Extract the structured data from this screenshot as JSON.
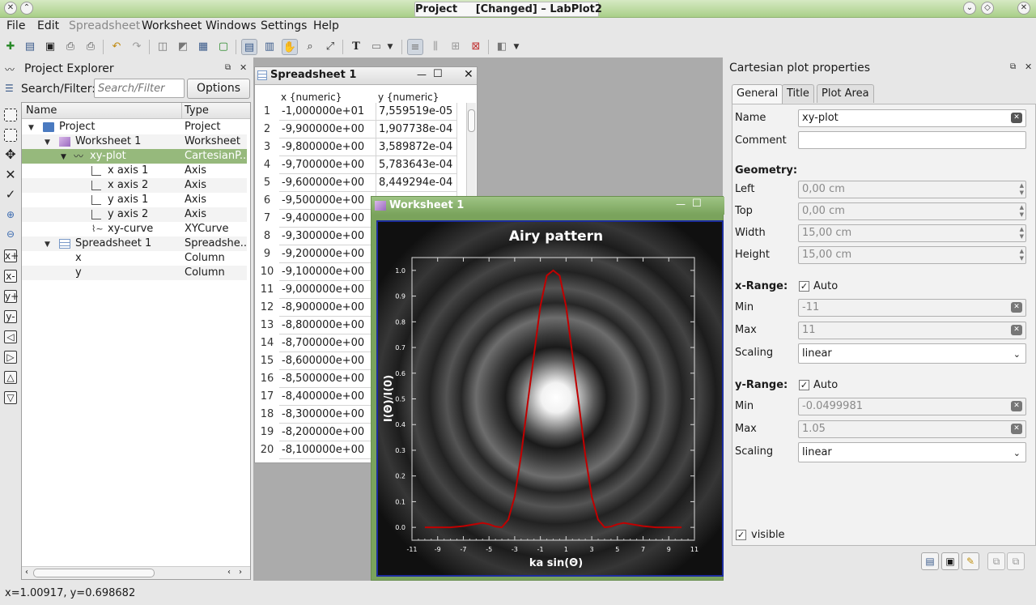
{
  "window": {
    "title": "Project     [Changed] – LabPlot2"
  },
  "menu": [
    "File",
    "Edit",
    "Spreadsheet",
    "Worksheet",
    "Windows",
    "Settings",
    "Help"
  ],
  "project_explorer": {
    "title": "Project Explorer",
    "search_label": "Search/Filter:",
    "search_placeholder": "Search/Filter",
    "options_label": "Options",
    "col_name": "Name",
    "col_type": "Type",
    "rows": [
      {
        "name": "Project",
        "type": "Project"
      },
      {
        "name": "Worksheet 1",
        "type": "Worksheet"
      },
      {
        "name": "xy-plot",
        "type": "CartesianP..."
      },
      {
        "name": "x axis 1",
        "type": "Axis"
      },
      {
        "name": "x axis 2",
        "type": "Axis"
      },
      {
        "name": "y axis 1",
        "type": "Axis"
      },
      {
        "name": "y axis 2",
        "type": "Axis"
      },
      {
        "name": "xy-curve",
        "type": "XYCurve"
      },
      {
        "name": "Spreadsheet 1",
        "type": "Spreadshe..."
      },
      {
        "name": "x",
        "type": "Column"
      },
      {
        "name": "y",
        "type": "Column"
      }
    ]
  },
  "spreadsheet": {
    "title": "Spreadsheet 1",
    "col_x": "x {numeric}",
    "col_y": "y {numeric}",
    "rows": [
      {
        "n": "1",
        "x": "-1,000000e+01",
        "y": "7,559519e-05"
      },
      {
        "n": "2",
        "x": "-9,900000e+00",
        "y": "1,907738e-04"
      },
      {
        "n": "3",
        "x": "-9,800000e+00",
        "y": "3,589872e-04"
      },
      {
        "n": "4",
        "x": "-9,700000e+00",
        "y": "5,783643e-04"
      },
      {
        "n": "5",
        "x": "-9,600000e+00",
        "y": "8,449294e-04"
      },
      {
        "n": "6",
        "x": "-9,500000e+00",
        "y": ""
      },
      {
        "n": "7",
        "x": "-9,400000e+00",
        "y": ""
      },
      {
        "n": "8",
        "x": "-9,300000e+00",
        "y": ""
      },
      {
        "n": "9",
        "x": "-9,200000e+00",
        "y": ""
      },
      {
        "n": "10",
        "x": "-9,100000e+00",
        "y": ""
      },
      {
        "n": "11",
        "x": "-9,000000e+00",
        "y": ""
      },
      {
        "n": "12",
        "x": "-8,900000e+00",
        "y": ""
      },
      {
        "n": "13",
        "x": "-8,800000e+00",
        "y": ""
      },
      {
        "n": "14",
        "x": "-8,700000e+00",
        "y": ""
      },
      {
        "n": "15",
        "x": "-8,600000e+00",
        "y": ""
      },
      {
        "n": "16",
        "x": "-8,500000e+00",
        "y": ""
      },
      {
        "n": "17",
        "x": "-8,400000e+00",
        "y": ""
      },
      {
        "n": "18",
        "x": "-8,300000e+00",
        "y": ""
      },
      {
        "n": "19",
        "x": "-8,200000e+00",
        "y": ""
      },
      {
        "n": "20",
        "x": "-8,100000e+00",
        "y": ""
      }
    ]
  },
  "worksheet": {
    "title": "Worksheet 1"
  },
  "chart_data": {
    "type": "line",
    "title": "Airy pattern",
    "xlabel": "ka sin(Θ)",
    "ylabel": "I(Θ)/I(0)",
    "xlim": [
      -11,
      11
    ],
    "ylim": [
      -0.0499981,
      1.05
    ],
    "x_ticks": [
      "-11",
      "-9",
      "-7",
      "-5",
      "-3",
      "-1",
      "1",
      "3",
      "5",
      "7",
      "9",
      "11"
    ],
    "y_ticks": [
      "0.0",
      "0.1",
      "0.2",
      "0.3",
      "0.4",
      "0.5",
      "0.6",
      "0.7",
      "0.8",
      "0.9",
      "1.0"
    ],
    "series": [
      {
        "color": "#c00000",
        "x": [
          -10,
          -9,
          -8,
          -7,
          -6,
          -5.5,
          -5,
          -4.5,
          -4,
          -3.5,
          -3,
          -2.5,
          -2,
          -1.5,
          -1,
          -0.5,
          0,
          0.5,
          1,
          1.5,
          2,
          2.5,
          3,
          3.5,
          4,
          4.5,
          5,
          5.5,
          6,
          7,
          8,
          9,
          10
        ],
        "y": [
          0,
          0,
          0,
          0.005,
          0.013,
          0.017,
          0.012,
          0.003,
          0,
          0.03,
          0.12,
          0.28,
          0.48,
          0.67,
          0.86,
          0.98,
          1.0,
          0.98,
          0.86,
          0.67,
          0.48,
          0.28,
          0.12,
          0.03,
          0,
          0.003,
          0.012,
          0.017,
          0.013,
          0.005,
          0,
          0,
          0
        ]
      }
    ]
  },
  "properties": {
    "title": "Cartesian plot properties",
    "tabs": [
      "General",
      "Title",
      "Plot Area"
    ],
    "name_label": "Name",
    "name_value": "xy-plot",
    "comment_label": "Comment",
    "geometry_label": "Geometry:",
    "left_label": "Left",
    "left_value": "0,00 cm",
    "top_label": "Top",
    "top_value": "0,00 cm",
    "width_label": "Width",
    "width_value": "15,00 cm",
    "height_label": "Height",
    "height_value": "15,00 cm",
    "xrange_label": "x-Range:",
    "auto_label": "Auto",
    "min_label": "Min",
    "xmin_value": "-11",
    "max_label": "Max",
    "xmax_value": "11",
    "scaling_label": "Scaling",
    "scaling_value": "linear",
    "yrange_label": "y-Range:",
    "ymin_value": "-0.0499981",
    "ymax_value": "1.05",
    "visible_label": "visible"
  },
  "status": {
    "coords": "x=1.00917, y=0.698682"
  }
}
